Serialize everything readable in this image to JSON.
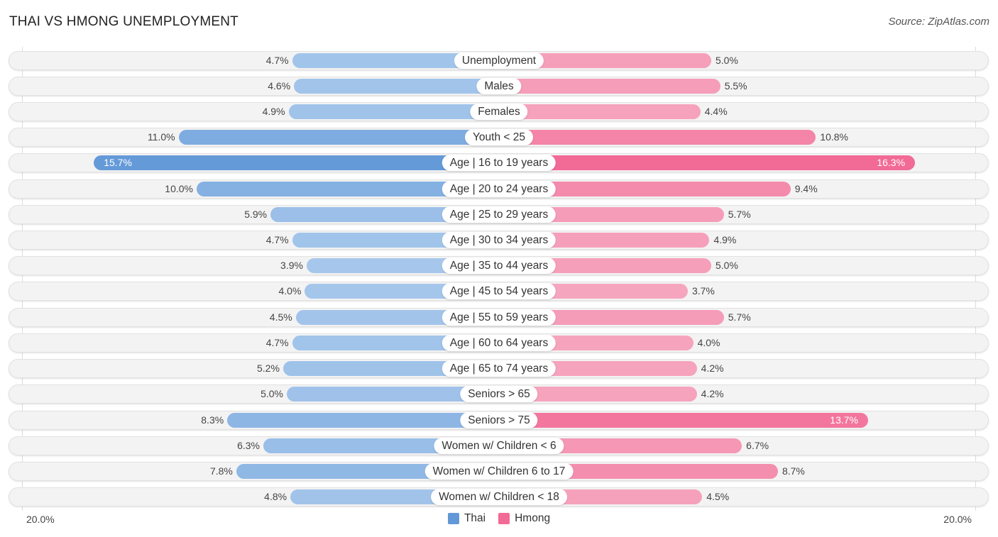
{
  "header": {
    "title": "THAI VS HMONG UNEMPLOYMENT",
    "source": "Source: ZipAtlas.com"
  },
  "colors": {
    "thai_light": "#a8c8ec",
    "thai_strong": "#6298d8",
    "hmong_light": "#f6a6bf",
    "hmong_strong": "#f26a96"
  },
  "chart_data": {
    "type": "bar",
    "orientation": "horizontal-diverging",
    "title": "THAI VS HMONG UNEMPLOYMENT",
    "categories": [
      "Unemployment",
      "Males",
      "Females",
      "Youth < 25",
      "Age | 16 to 19 years",
      "Age | 20 to 24 years",
      "Age | 25 to 29 years",
      "Age | 30 to 34 years",
      "Age | 35 to 44 years",
      "Age | 45 to 54 years",
      "Age | 55 to 59 years",
      "Age | 60 to 64 years",
      "Age | 65 to 74 years",
      "Seniors > 65",
      "Seniors > 75",
      "Women w/ Children < 6",
      "Women w/ Children 6 to 17",
      "Women w/ Children < 18"
    ],
    "series": [
      {
        "name": "Thai",
        "side": "left",
        "values": [
          4.7,
          4.6,
          4.9,
          11.0,
          15.7,
          10.0,
          5.9,
          4.7,
          3.9,
          4.0,
          4.5,
          4.7,
          5.2,
          5.0,
          8.3,
          6.3,
          7.8,
          4.8
        ],
        "labels": [
          "4.7%",
          "4.6%",
          "4.9%",
          "11.0%",
          "15.7%",
          "10.0%",
          "5.9%",
          "4.7%",
          "3.9%",
          "4.0%",
          "4.5%",
          "4.7%",
          "5.2%",
          "5.0%",
          "8.3%",
          "6.3%",
          "7.8%",
          "4.8%"
        ]
      },
      {
        "name": "Hmong",
        "side": "right",
        "values": [
          5.0,
          5.5,
          4.4,
          10.8,
          16.3,
          9.4,
          5.7,
          4.9,
          5.0,
          3.7,
          5.7,
          4.0,
          4.2,
          4.2,
          13.7,
          6.7,
          8.7,
          4.5
        ],
        "labels": [
          "5.0%",
          "5.5%",
          "4.4%",
          "10.8%",
          "16.3%",
          "9.4%",
          "5.7%",
          "4.9%",
          "5.0%",
          "3.7%",
          "5.7%",
          "4.0%",
          "4.2%",
          "4.2%",
          "13.7%",
          "6.7%",
          "8.7%",
          "4.5%"
        ]
      }
    ],
    "xlim": [
      0,
      20
    ],
    "axis_labels": {
      "left": "20.0%",
      "right": "20.0%"
    },
    "unit": "%",
    "legend": {
      "position": "bottom-center",
      "entries": [
        "Thai",
        "Hmong"
      ]
    }
  }
}
